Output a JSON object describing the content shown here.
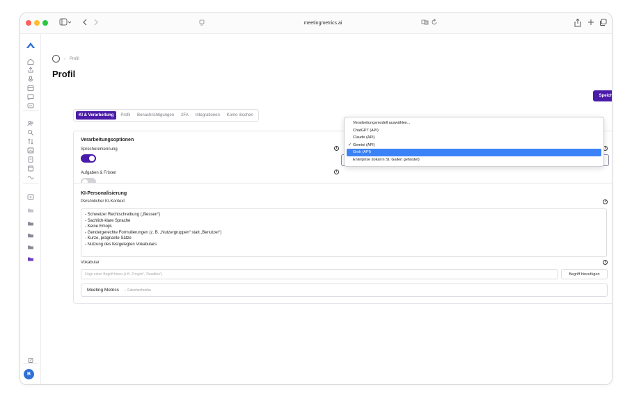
{
  "browser": {
    "url": "meetingmetrics.ai",
    "traffic_lights": [
      "#ff5f57",
      "#febc2e",
      "#28c840"
    ]
  },
  "breadcrumb": {
    "current": "Profil"
  },
  "page": {
    "title": "Profil",
    "save_label": "Speichern"
  },
  "tabs": [
    {
      "label": "KI & Verarbeitung",
      "active": true
    },
    {
      "label": "Profil",
      "active": false
    },
    {
      "label": "Benachrichtigungen",
      "active": false
    },
    {
      "label": "2FA",
      "active": false
    },
    {
      "label": "Integrationen",
      "active": false
    },
    {
      "label": "Konto löschen",
      "active": false
    }
  ],
  "processing": {
    "title": "Verarbeitungsoptionen",
    "speaker_label": "Sprechererkennung",
    "speaker_on": true,
    "tasks_label": "Aufgaben & Fristen",
    "tasks_on": false
  },
  "dropdown": {
    "options": [
      {
        "label": "Verarbeitungsmodell auswählen...",
        "checked": false,
        "highlighted": false
      },
      {
        "label": "ChatGPT (API)",
        "checked": false,
        "highlighted": false
      },
      {
        "label": "Claude (API)",
        "checked": false,
        "highlighted": false
      },
      {
        "label": "Gemini (API)",
        "checked": true,
        "highlighted": false
      },
      {
        "label": "Grok (API)",
        "checked": false,
        "highlighted": true
      },
      {
        "label": "Enterprise (lokal in St. Gallen gehostet)",
        "checked": false,
        "highlighted": false
      }
    ],
    "check_glyph": "✓"
  },
  "personalization": {
    "title": "KI-Personalisierung",
    "context_label": "Persönlicher KI-Kontext",
    "context_lines": [
      "- Schweizer Rechtschreibung („fliessen“)",
      "- Sachlich-klare Sprache",
      "- Keine Emojis",
      "- Gendergerechte Formulierungen (z. B. „Nutzergruppen“ statt „Benutzer“)",
      "- Kurze, prägnante Sätze",
      "- Nutzung des festgelegten Vokabulars"
    ],
    "vocab_label": "Vokabular",
    "vocab_placeholder": "Füge einen Begriff hinzu (z.B. 'Projekt', 'Deadline')",
    "add_term_label": "Begriff hinzufügen",
    "vocab_term": "Meeting Metrics",
    "vocab_wrong": "→ Falschschreibu"
  },
  "user": {
    "avatar_initial": "B"
  },
  "colors": {
    "accent": "#4a1aa8",
    "highlight": "#3b82f6",
    "toggle_off": "#d4d4d8"
  }
}
